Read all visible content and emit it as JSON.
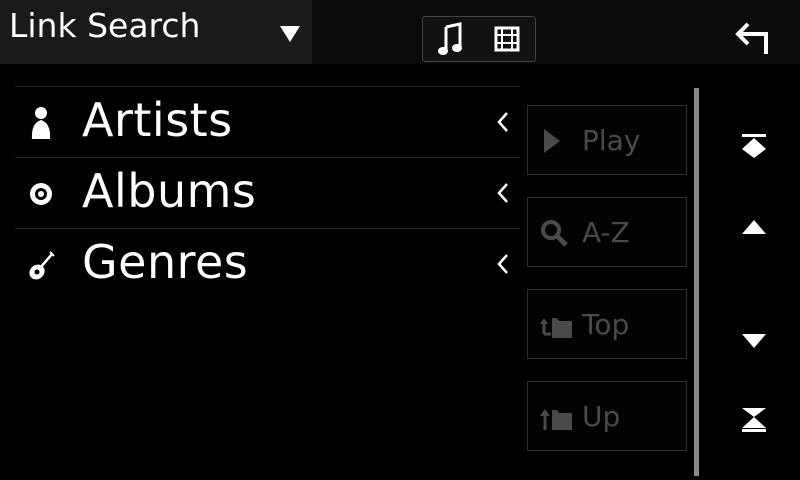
{
  "header": {
    "title": "Link Search",
    "dropdown_icon": "triangle-down-icon",
    "media_tabs": [
      {
        "name": "music",
        "icon": "music-note-icon",
        "selected": true
      },
      {
        "name": "video",
        "icon": "film-icon",
        "selected": false
      }
    ],
    "back_icon": "back-arrow-icon"
  },
  "categories": [
    {
      "label": "Artists",
      "icon": "person-icon"
    },
    {
      "label": "Albums",
      "icon": "disc-icon"
    },
    {
      "label": "Genres",
      "icon": "guitar-icon"
    }
  ],
  "actions": [
    {
      "label": "Play",
      "icon": "play-icon"
    },
    {
      "label": "A-Z",
      "icon": "search-icon"
    },
    {
      "label": "Top",
      "icon": "folder-top-icon"
    },
    {
      "label": "Up",
      "icon": "folder-up-icon"
    }
  ],
  "navigation": [
    "jump-to-top-icon",
    "scroll-up-icon",
    "scroll-down-icon",
    "jump-to-bottom-icon"
  ],
  "colors": {
    "background": "#000000",
    "text": "#ffffff",
    "disabled_text": "#4a4a4a",
    "header_bg": "#1a1a1a",
    "scrollbar": "#8a8a8a"
  }
}
